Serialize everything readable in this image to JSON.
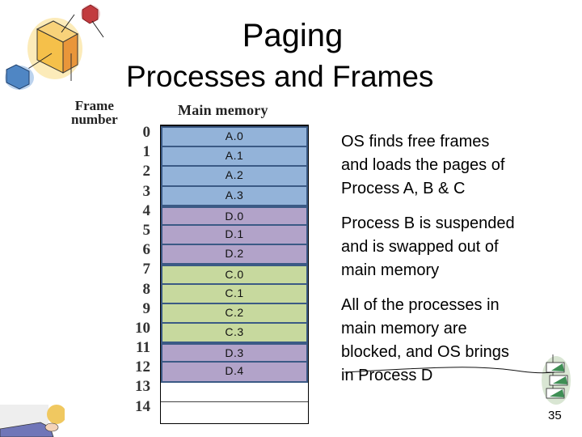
{
  "slide": {
    "title": "Paging",
    "subtitle": "Processes and Frames",
    "page_number": "35"
  },
  "diagram": {
    "frame_label_line1": "Frame",
    "frame_label_line2": "number",
    "memory_label": "Main memory",
    "frames": [
      {
        "number": "0",
        "content": "A.0",
        "process": "A"
      },
      {
        "number": "1",
        "content": "A.1",
        "process": "A"
      },
      {
        "number": "2",
        "content": "A.2",
        "process": "A"
      },
      {
        "number": "3",
        "content": "A.3",
        "process": "A"
      },
      {
        "number": "4",
        "content": "D.0",
        "process": "D"
      },
      {
        "number": "5",
        "content": "D.1",
        "process": "D"
      },
      {
        "number": "6",
        "content": "D.2",
        "process": "D"
      },
      {
        "number": "7",
        "content": "C.0",
        "process": "C"
      },
      {
        "number": "8",
        "content": "C.1",
        "process": "C"
      },
      {
        "number": "9",
        "content": "C.2",
        "process": "C"
      },
      {
        "number": "10",
        "content": "C.3",
        "process": "C"
      },
      {
        "number": "11",
        "content": "D.3",
        "process": "D"
      },
      {
        "number": "12",
        "content": "D.4",
        "process": "D"
      },
      {
        "number": "13",
        "content": "",
        "process": ""
      },
      {
        "number": "14",
        "content": "",
        "process": ""
      }
    ],
    "colors": {
      "A": "#93b3d9",
      "D": "#b2a3c9",
      "C": "#c7d99e",
      "border": "#3b5a85"
    }
  },
  "notes": [
    {
      "lines": [
        "OS finds free frames",
        "and loads the pages of",
        "Process A, B & C"
      ]
    },
    {
      "lines": [
        "Process B is suspended",
        "and is swapped out of",
        "main memory"
      ]
    },
    {
      "lines": [
        "All of the processes in",
        "main memory are",
        "blocked, and OS brings",
        "in Process D"
      ]
    }
  ],
  "icons": {
    "top_left": "cubes-clipart-icon",
    "bottom_left": "hand-clipart-icon",
    "bottom_right": "stacked-blocks-clipart-icon"
  }
}
